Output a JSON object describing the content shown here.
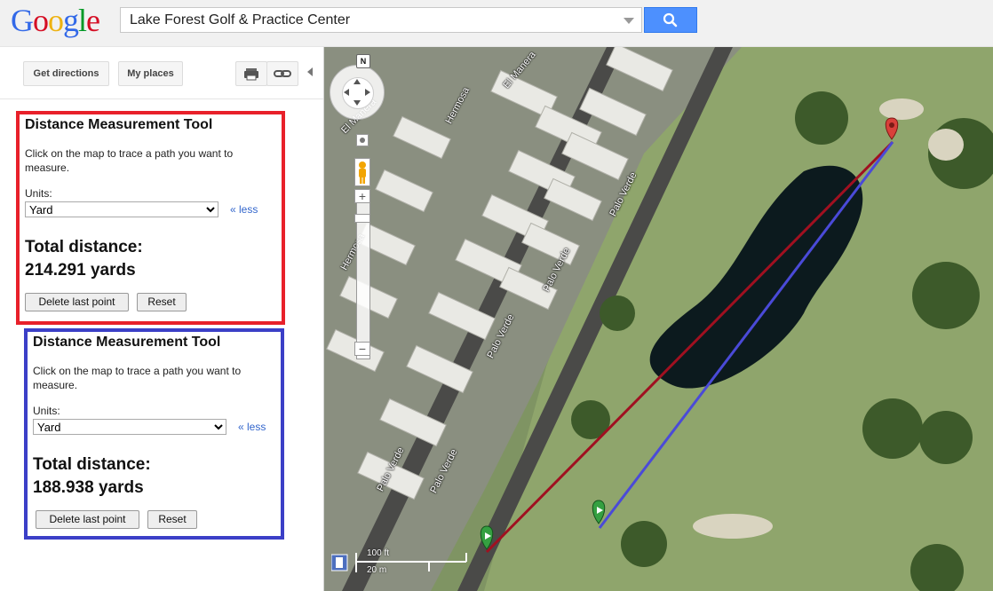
{
  "header": {
    "logo": [
      "G",
      "o",
      "o",
      "g",
      "l",
      "e"
    ],
    "search_value": "Lake Forest Golf & Practice Center",
    "search_button_icon": "search-icon"
  },
  "sidebar": {
    "get_directions": "Get directions",
    "my_places": "My places",
    "print_icon": "print-icon",
    "link_icon": "link-icon"
  },
  "panels": [
    {
      "title": "Distance Measurement Tool",
      "description": "Click on the map to trace a path you want to measure.",
      "units_label": "Units:",
      "units_value": "Yard",
      "less_link": "« less",
      "total_label": "Total distance:",
      "total_value": "214.291 yards",
      "delete_button": "Delete last point",
      "reset_button": "Reset",
      "border_color": "#e8202a"
    },
    {
      "title": "Distance Measurement Tool",
      "description": "Click on the map to trace a path you want to measure.",
      "units_label": "Units:",
      "units_value": "Yard",
      "less_link": "« less",
      "total_label": "Total distance:",
      "total_value": "188.938 yards",
      "delete_button": "Delete last point",
      "reset_button": "Reset",
      "border_color": "#3b3fc7"
    }
  ],
  "map": {
    "streets": [
      "El Manera",
      "El Manera",
      "Hermosa",
      "Hermosa",
      "Palo Verde",
      "Palo Verde",
      "Palo Verde",
      "Palo Verde",
      "Palo Verde"
    ],
    "compass": "N",
    "zoom_in": "+",
    "zoom_out": "−",
    "scale_feet": "100 ft",
    "scale_meters": "20 m",
    "red_path_color": "#a01020",
    "blue_path_color": "#4a4ad8"
  }
}
